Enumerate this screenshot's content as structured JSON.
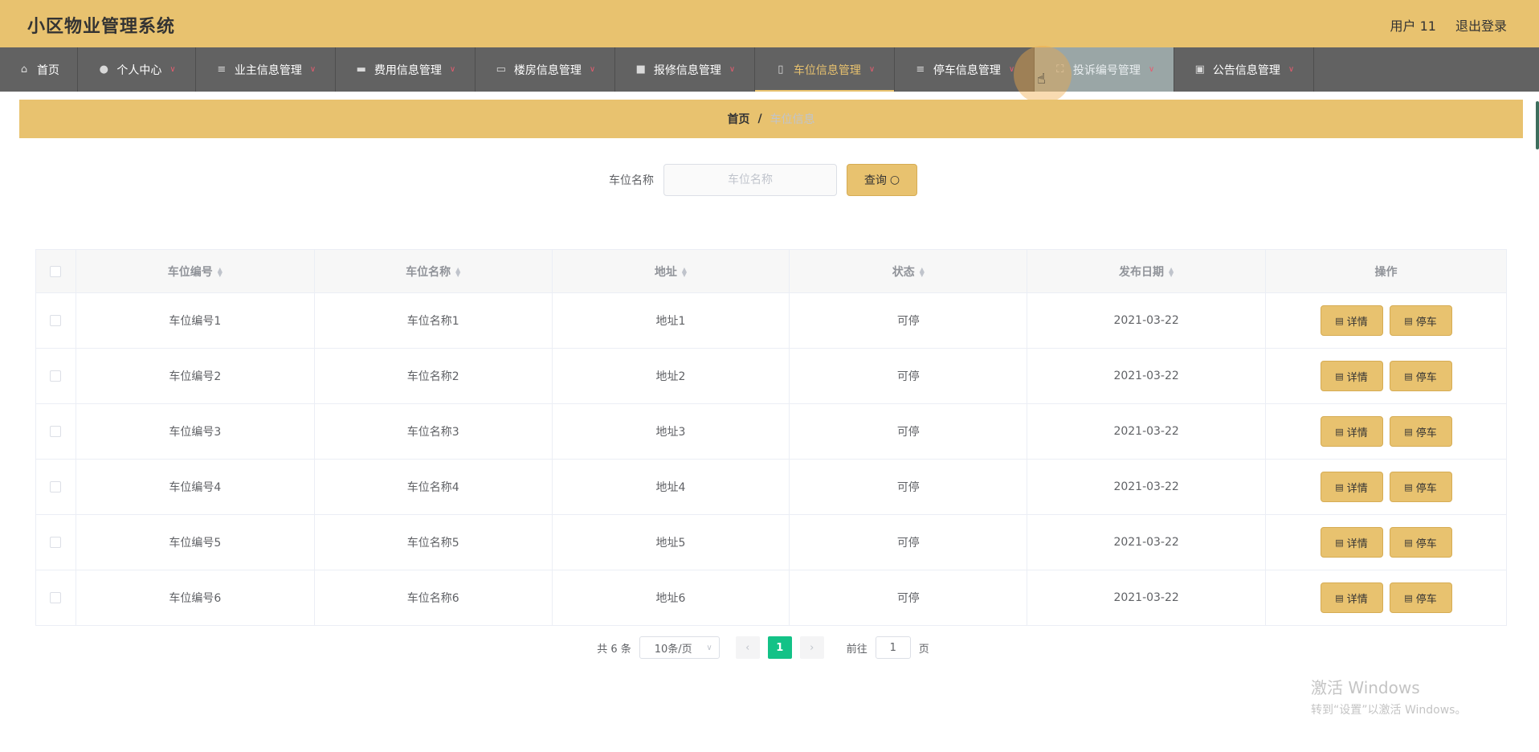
{
  "header": {
    "title": "小区物业管理系统",
    "user": "用户 11",
    "logout": "退出登录"
  },
  "nav": [
    {
      "label": "首页",
      "icon": "home-icon",
      "glyph": "⌂",
      "chev": false
    },
    {
      "label": "个人中心",
      "icon": "user-icon",
      "glyph": "●",
      "chev": true
    },
    {
      "label": "业主信息管理",
      "icon": "list-icon",
      "glyph": "≡",
      "chev": true
    },
    {
      "label": "费用信息管理",
      "icon": "fee-icon",
      "glyph": "▬",
      "chev": true
    },
    {
      "label": "楼房信息管理",
      "icon": "chat-icon",
      "glyph": "▭",
      "chev": true
    },
    {
      "label": "报修信息管理",
      "icon": "briefcase-icon",
      "glyph": "■",
      "chev": true
    },
    {
      "label": "车位信息管理",
      "icon": "phone-icon",
      "glyph": "▯",
      "chev": true,
      "active": true
    },
    {
      "label": "停车信息管理",
      "icon": "menu-icon",
      "glyph": "≡",
      "chev": true
    },
    {
      "label": "投诉编号管理",
      "icon": "frame-icon",
      "glyph": "⛶",
      "chev": true,
      "hover": true
    },
    {
      "label": "公告信息管理",
      "icon": "clipboard-icon",
      "glyph": "▣",
      "chev": true
    }
  ],
  "breadcrumb": {
    "home": "首页",
    "separator": "/",
    "current": "车位信息"
  },
  "search": {
    "label": "车位名称",
    "placeholder": "车位名称",
    "button": "查询",
    "button_icon": "○"
  },
  "table": {
    "headers": [
      "车位编号",
      "车位名称",
      "地址",
      "状态",
      "发布日期",
      "操作"
    ],
    "rows": [
      {
        "id": "车位编号1",
        "name": "车位名称1",
        "address": "地址1",
        "status": "可停",
        "date": "2021-03-22"
      },
      {
        "id": "车位编号2",
        "name": "车位名称2",
        "address": "地址2",
        "status": "可停",
        "date": "2021-03-22"
      },
      {
        "id": "车位编号3",
        "name": "车位名称3",
        "address": "地址3",
        "status": "可停",
        "date": "2021-03-22"
      },
      {
        "id": "车位编号4",
        "name": "车位名称4",
        "address": "地址4",
        "status": "可停",
        "date": "2021-03-22"
      },
      {
        "id": "车位编号5",
        "name": "车位名称5",
        "address": "地址5",
        "status": "可停",
        "date": "2021-03-22"
      },
      {
        "id": "车位编号6",
        "name": "车位名称6",
        "address": "地址6",
        "status": "可停",
        "date": "2021-03-22"
      }
    ],
    "actions": {
      "detail": "详情",
      "park": "停车",
      "icon": "document-icon",
      "glyph": "▤"
    }
  },
  "pagination": {
    "total": "共 6 条",
    "page_size": "10条/页",
    "prev": "‹",
    "next": "›",
    "current_page": "1",
    "goto_label": "前往",
    "goto_value": "1",
    "goto_suffix": "页"
  },
  "watermark": {
    "line1": "激活 Windows",
    "line2": "转到“设置”以激活 Windows。"
  },
  "colors": {
    "accent": "#e8c26f",
    "nav_bg": "#626262",
    "active_page": "#13c287"
  }
}
